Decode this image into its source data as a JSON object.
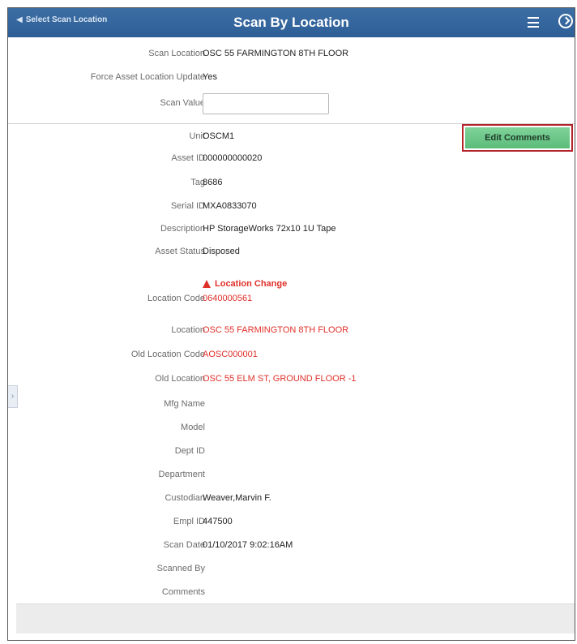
{
  "header": {
    "back_label": "Select Scan Location",
    "title": "Scan By Location"
  },
  "scan": {
    "location_label": "Scan Location",
    "location_value": "OSC 55 FARMINGTON 8TH FLOOR",
    "force_label": "Force Asset Location Update",
    "force_value": "Yes",
    "scan_value_label": "Scan Value",
    "scan_value": ""
  },
  "edit_comments_label": "Edit Comments",
  "location_change_label": "Location Change",
  "fields": [
    {
      "label": "Unit",
      "value": "OSCM1",
      "red": false
    },
    {
      "label": "Asset ID",
      "value": "000000000020",
      "red": false
    },
    {
      "label": "Tag",
      "value": "8686",
      "red": false
    },
    {
      "label": "Serial ID",
      "value": "MXA0833070",
      "red": false
    },
    {
      "label": "Description",
      "value": "HP StorageWorks 72x10 1U Tape",
      "red": false
    },
    {
      "label": "Asset Status",
      "value": "Disposed",
      "red": false
    },
    {
      "label": "Location Code",
      "value": "0640000561",
      "red": true
    },
    {
      "label": "Location",
      "value": "OSC 55 FARMINGTON 8TH FLOOR",
      "red": true
    },
    {
      "label": "Old Location Code",
      "value": "AOSC000001",
      "red": true
    },
    {
      "label": "Old Location",
      "value": "OSC 55 ELM ST, GROUND FLOOR -1",
      "red": true
    },
    {
      "label": "Mfg Name",
      "value": "",
      "red": false
    },
    {
      "label": "Model",
      "value": "",
      "red": false
    },
    {
      "label": "Dept ID",
      "value": "",
      "red": false
    },
    {
      "label": "Department",
      "value": "",
      "red": false
    },
    {
      "label": "Custodian",
      "value": "Weaver,Marvin F.",
      "red": false
    },
    {
      "label": "Empl ID",
      "value": "447500",
      "red": false
    },
    {
      "label": "Scan Date",
      "value": "01/10/2017  9:02:16AM",
      "red": false
    },
    {
      "label": "Scanned By",
      "value": "",
      "red": false
    },
    {
      "label": "Comments",
      "value": "",
      "red": false
    }
  ],
  "colors": {
    "header": "#2e5e96",
    "alert_red": "#e0302a",
    "button_green": "#5cbc7a",
    "button_border": "#b3232a"
  }
}
